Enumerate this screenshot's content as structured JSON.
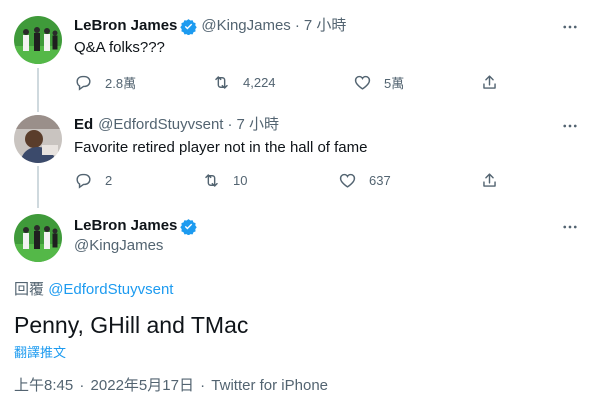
{
  "tweets": [
    {
      "display_name": "LeBron James",
      "handle": "@KingJames",
      "separator": "·",
      "time": "7 小時",
      "text": "Q&A folks???",
      "verified": true,
      "actions": {
        "reply": "2.8萬",
        "retweet": "4,224",
        "like": "5萬"
      }
    },
    {
      "display_name": "Ed",
      "handle": "@EdfordStuyvsent",
      "separator": "·",
      "time": "7 小時",
      "text": "Favorite retired player not in the hall of fame",
      "verified": false,
      "actions": {
        "reply": "2",
        "retweet": "10",
        "like": "637"
      }
    }
  ],
  "main_tweet": {
    "display_name": "LeBron James",
    "handle": "@KingJames",
    "verified": true,
    "reply_prefix": "回覆",
    "reply_mention": "@EdfordStuyvsent",
    "text": "Penny, GHill and TMac",
    "translate_label": "翻譯推文",
    "time": "上午8:45",
    "separator": "·",
    "date": "2022年5月17日",
    "client": "Twitter for iPhone"
  },
  "icons": {
    "reply": "reply-icon",
    "retweet": "retweet-icon",
    "like": "heart-icon",
    "share": "share-icon",
    "more": "more-icon",
    "verified": "verified-badge-icon"
  },
  "colors": {
    "accent": "#1d9bf0",
    "text": "#0f1419",
    "secondary": "#536471",
    "thread_line": "#cfd9de"
  }
}
